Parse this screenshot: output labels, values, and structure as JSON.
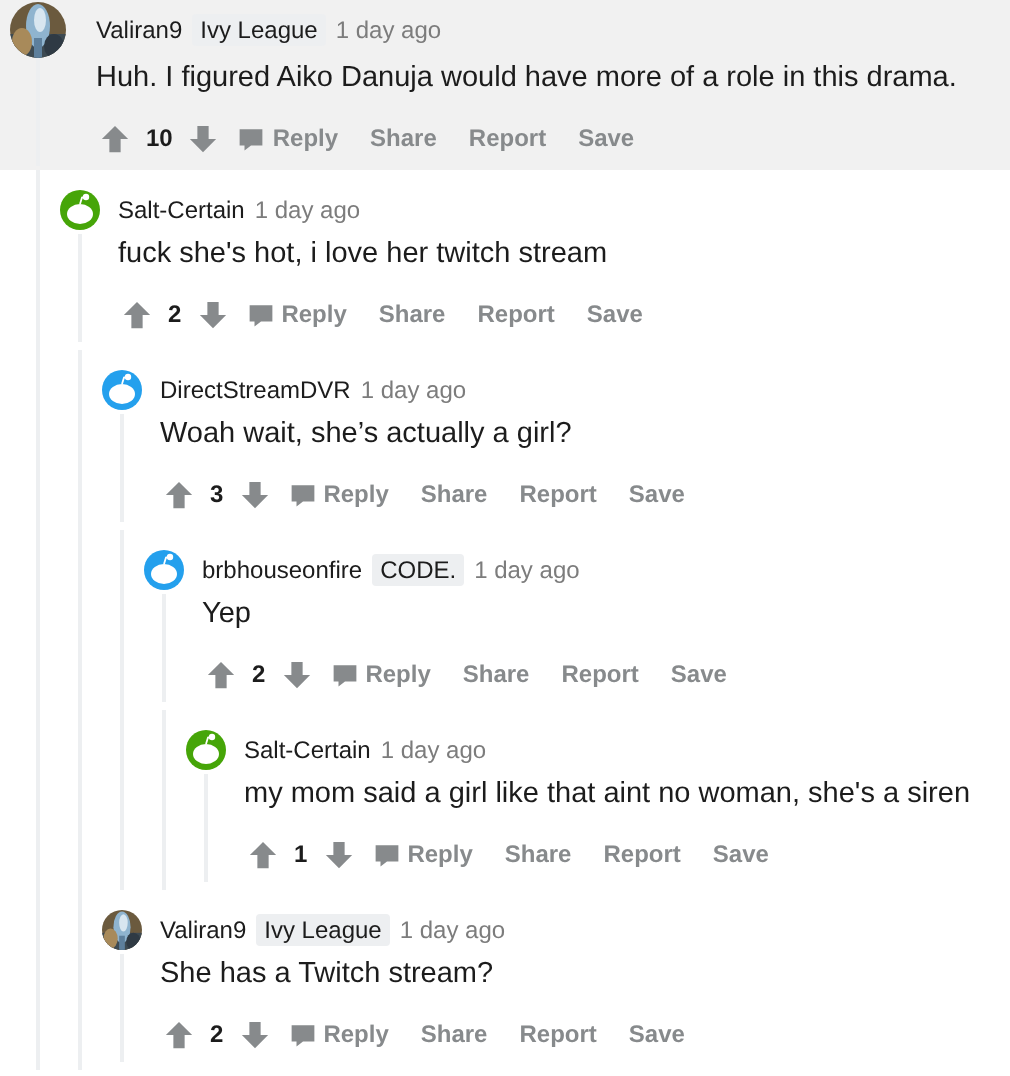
{
  "comments": [
    {
      "author": "Valiran9",
      "flair": "Ivy League",
      "time": "1 day ago",
      "avatar": {
        "kind": "picture"
      },
      "highlighted": true,
      "text": "Huh. I figured Aiko Danuja would have more of a role in this drama.",
      "score": "10",
      "actions": [
        "Reply",
        "Share",
        "Report",
        "Save"
      ],
      "children": [
        {
          "author": "Salt-Certain",
          "time": "1 day ago",
          "avatar": {
            "kind": "default",
            "color": "#46a508"
          },
          "highlighted": false,
          "text": "fuck she's hot, i love her twitch stream",
          "score": "2",
          "actions": [
            "Reply",
            "Share",
            "Report",
            "Save"
          ],
          "children": [
            {
              "author": "DirectStreamDVR",
              "time": "1 day ago",
              "avatar": {
                "kind": "default",
                "color": "#24a0ed"
              },
              "highlighted": false,
              "text": "Woah wait, she’s actually a girl?",
              "score": "3",
              "actions": [
                "Reply",
                "Share",
                "Report",
                "Save"
              ],
              "children": [
                {
                  "author": "brbhouseonfire",
                  "flair": "CODE.",
                  "time": "1 day ago",
                  "avatar": {
                    "kind": "default",
                    "color": "#24a0ed"
                  },
                  "highlighted": false,
                  "text": "Yep",
                  "score": "2",
                  "actions": [
                    "Reply",
                    "Share",
                    "Report",
                    "Save"
                  ],
                  "children": [
                    {
                      "author": "Salt-Certain",
                      "time": "1 day ago",
                      "avatar": {
                        "kind": "default",
                        "color": "#46a508"
                      },
                      "highlighted": false,
                      "text": "my mom said a girl like that aint no woman, she's a siren",
                      "score": "1",
                      "actions": [
                        "Reply",
                        "Share",
                        "Report",
                        "Save"
                      ]
                    }
                  ]
                }
              ]
            },
            {
              "author": "Valiran9",
              "flair": "Ivy League",
              "time": "1 day ago",
              "avatar": {
                "kind": "picture"
              },
              "highlighted": false,
              "text": "She has a Twitch stream?",
              "score": "2",
              "actions": [
                "Reply",
                "Share",
                "Report",
                "Save"
              ]
            }
          ]
        }
      ]
    }
  ]
}
